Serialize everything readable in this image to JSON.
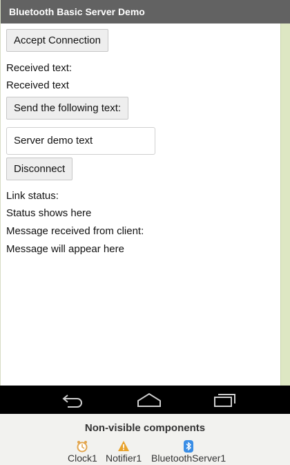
{
  "app": {
    "title": "Bluetooth Basic Server Demo"
  },
  "buttons": {
    "accept": "Accept Connection",
    "send": "Send the following text:",
    "disconnect": "Disconnect"
  },
  "labels": {
    "received_text_heading": "Received text:",
    "received_text_value": "Received text",
    "link_status_heading": "Link status:",
    "link_status_value": "Status shows here",
    "message_heading": "Message received from client:",
    "message_value": "Message will appear here"
  },
  "textbox": {
    "value": "Server demo text"
  },
  "navbar": {
    "icons": [
      "back-icon",
      "home-icon",
      "recent-apps-icon"
    ]
  },
  "nonvisible": {
    "title": "Non-visible components",
    "components": [
      {
        "name": "Clock1",
        "icon": "clock-icon"
      },
      {
        "name": "Notifier1",
        "icon": "warning-icon"
      },
      {
        "name": "BluetoothServer1",
        "icon": "bluetooth-icon"
      }
    ]
  },
  "colors": {
    "titlebar": "#626262",
    "navbar": "#000000",
    "side_strip": "#dde7c3",
    "panel": "#f2f2ef"
  }
}
